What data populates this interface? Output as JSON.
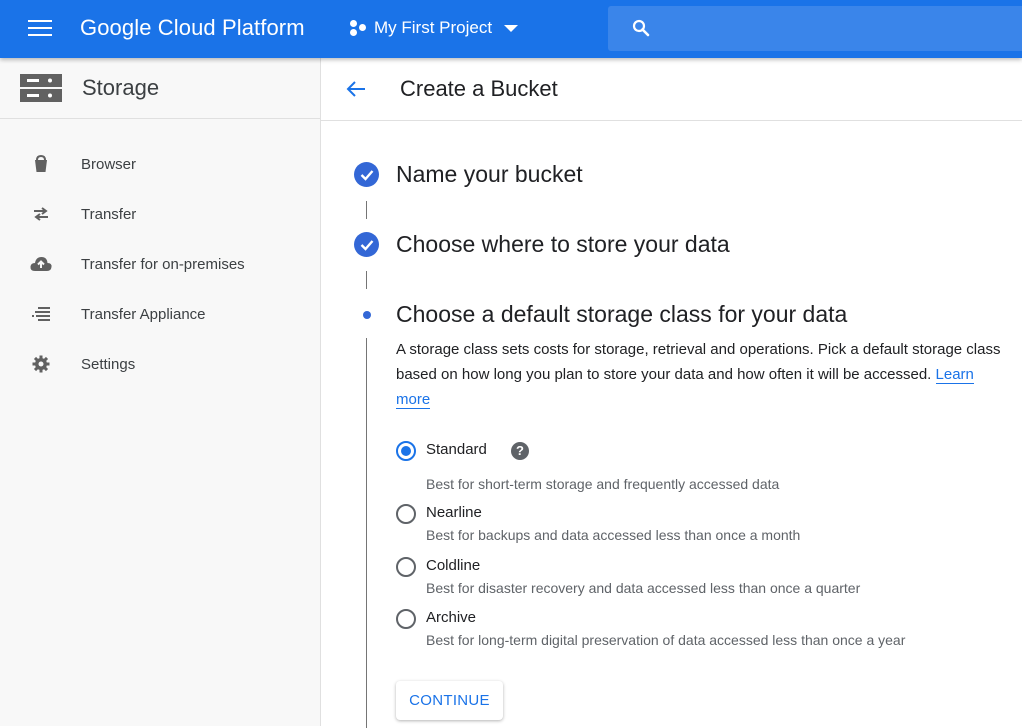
{
  "topbar": {
    "brand": "Google Cloud Platform",
    "project": "My First Project",
    "search_placeholder": ""
  },
  "sidebar": {
    "title": "Storage",
    "items": [
      {
        "label": "Browser",
        "icon": "bucket-icon"
      },
      {
        "label": "Transfer",
        "icon": "transfer-arrows-icon"
      },
      {
        "label": "Transfer for on-premises",
        "icon": "cloud-upload-icon"
      },
      {
        "label": "Transfer Appliance",
        "icon": "appliance-list-icon"
      },
      {
        "label": "Settings",
        "icon": "gear-icon"
      }
    ]
  },
  "main": {
    "title": "Create a Bucket",
    "steps": [
      {
        "label": "Name your bucket",
        "status": "complete"
      },
      {
        "label": "Choose where to store your data",
        "status": "complete"
      },
      {
        "label": "Choose a default storage class for your data",
        "status": "current"
      }
    ],
    "description": "A storage class sets costs for storage, retrieval and operations. Pick a default storage class based on how long you plan to store your data and how often it will be accessed.",
    "learn_more": "Learn more",
    "options": [
      {
        "name": "Standard",
        "desc": "Best for short-term storage and frequently accessed data",
        "selected": true
      },
      {
        "name": "Nearline",
        "desc": "Best for backups and data accessed less than once a month",
        "selected": false
      },
      {
        "name": "Coldline",
        "desc": "Best for disaster recovery and data accessed less than once a quarter",
        "selected": false
      },
      {
        "name": "Archive",
        "desc": "Best for long-term digital preservation of data accessed less than once a year",
        "selected": false
      }
    ],
    "help_glyph": "?",
    "continue_label": "CONTINUE"
  },
  "colors": {
    "brand_blue": "#1a73e8",
    "step_blue": "#3367d6",
    "sidebar_bg": "#f8f8f8"
  }
}
